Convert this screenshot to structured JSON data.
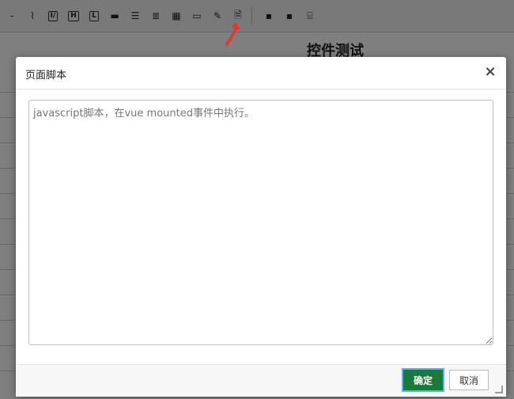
{
  "background": {
    "page_title": "控件测试",
    "toolbar": [
      {
        "icon": "dash-icon",
        "glyph": "-"
      },
      {
        "icon": "paperclip-icon",
        "glyph": "⌇"
      },
      {
        "icon": "textbox-icon",
        "glyph": "I/"
      },
      {
        "icon": "heading-icon",
        "glyph": "H"
      },
      {
        "icon": "label-icon",
        "glyph": "L"
      },
      {
        "icon": "input-bar-icon",
        "glyph": "▬"
      },
      {
        "icon": "list-icon",
        "glyph": "☰"
      },
      {
        "icon": "ordered-list-icon",
        "glyph": "≣"
      },
      {
        "icon": "table-icon",
        "glyph": "▦"
      },
      {
        "icon": "window-icon",
        "glyph": "▭"
      },
      {
        "icon": "pencil-icon",
        "glyph": "✎"
      },
      {
        "icon": "page-script-icon",
        "glyph": "🗎"
      },
      {
        "icon": "save-icon",
        "glyph": "▪"
      },
      {
        "icon": "save-as-icon",
        "glyph": "▪"
      },
      {
        "icon": "preview-icon",
        "glyph": "⌸"
      }
    ]
  },
  "dialog": {
    "title": "页面脚本",
    "close_glyph": "×",
    "script_placeholder": "javascript脚本，在vue mounted事件中执行。",
    "ok_label": "确定",
    "cancel_label": "取消"
  },
  "colors": {
    "ok_button": "#1a7a3a",
    "arrow": "#e8322b",
    "overlay": "rgba(0,0,0,0.5)"
  }
}
